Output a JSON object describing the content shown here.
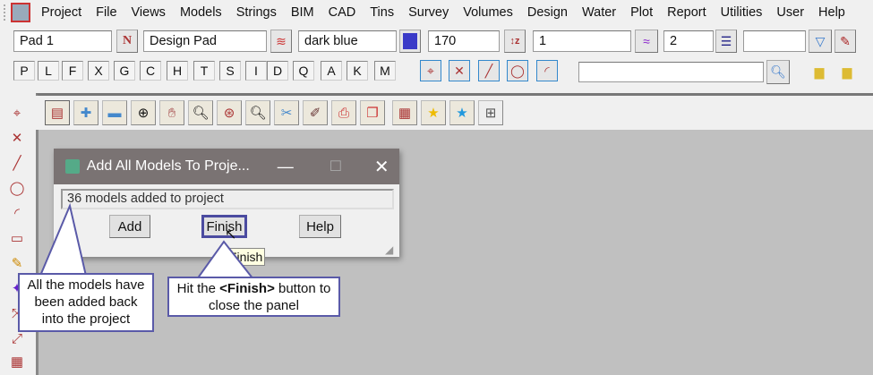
{
  "menu": [
    "Project",
    "File",
    "Views",
    "Models",
    "Strings",
    "BIM",
    "CAD",
    "Tins",
    "Survey",
    "Volumes",
    "Design",
    "Water",
    "Plot",
    "Report",
    "Utilities",
    "User",
    "Help"
  ],
  "toolbar1": {
    "name": "Pad 1",
    "name_icon": "N",
    "style": "Design Pad",
    "colour": "dark blue",
    "colour_hex": "#3b3bc8",
    "height": "170",
    "field1": "1",
    "field2": "2",
    "field3": ""
  },
  "letters": [
    "P",
    "L",
    "F",
    "X",
    "G",
    "C",
    "H",
    "T",
    "S",
    "I",
    "D",
    "Q",
    "A",
    "K",
    "M"
  ],
  "search": {
    "value": ""
  },
  "dialog": {
    "title": "Add All Models To Proje...",
    "message": "36 models added to project",
    "add": "Add",
    "finish": "Finish",
    "help": "Help",
    "tooltip": "Finish"
  },
  "callouts": {
    "left": "All the models have been added back into the project",
    "right_pre": "Hit the ",
    "right_bold": "<Finish>",
    "right_post": " button to close the panel"
  }
}
